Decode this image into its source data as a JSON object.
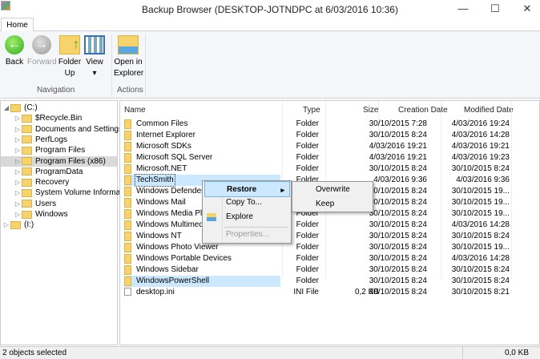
{
  "window": {
    "title": "Backup Browser (DESKTOP-JOTNDPC at 6/03/2016 10:36)",
    "minimize": "—",
    "maximize": "☐",
    "close": "✕"
  },
  "ribbon": {
    "tab": "Home",
    "buttons": [
      {
        "l1": "Back",
        "l2": ""
      },
      {
        "l1": "Forward",
        "l2": ""
      },
      {
        "l1": "Folder",
        "l2": "Up"
      },
      {
        "l1": "View",
        "l2": "▾"
      },
      {
        "l1": "Open in",
        "l2": "Explorer"
      }
    ],
    "groups": [
      "Navigation",
      "Actions"
    ]
  },
  "tree": [
    {
      "label": "(C:)",
      "arrow": "◢",
      "level": 0
    },
    {
      "label": "$Recycle.Bin",
      "arrow": "▷",
      "level": 1
    },
    {
      "label": "Documents and Settings",
      "arrow": "▷",
      "level": 1
    },
    {
      "label": "PerfLogs",
      "arrow": "▷",
      "level": 1
    },
    {
      "label": "Program Files",
      "arrow": "▷",
      "level": 1
    },
    {
      "label": "Program Files (x86)",
      "arrow": "▷",
      "level": 1,
      "selected": true
    },
    {
      "label": "ProgramData",
      "arrow": "▷",
      "level": 1
    },
    {
      "label": "Recovery",
      "arrow": "▷",
      "level": 1
    },
    {
      "label": "System Volume Informati",
      "arrow": "▷",
      "level": 1
    },
    {
      "label": "Users",
      "arrow": "▷",
      "level": 1
    },
    {
      "label": "Windows",
      "arrow": "▷",
      "level": 1
    },
    {
      "label": "(I:)",
      "arrow": "▷",
      "level": 0
    }
  ],
  "columns": {
    "name": "Name",
    "type": "Type",
    "size": "Size",
    "created": "Creation Date",
    "modified": "Modified Date"
  },
  "files": [
    {
      "name": "Common Files",
      "type": "Folder",
      "size": "",
      "created": "30/10/2015 7:28",
      "modified": "4/03/2016 19:24"
    },
    {
      "name": "Internet Explorer",
      "type": "Folder",
      "size": "",
      "created": "30/10/2015 8:24",
      "modified": "4/03/2016 14:28"
    },
    {
      "name": "Microsoft SDKs",
      "type": "Folder",
      "size": "",
      "created": "4/03/2016 19:21",
      "modified": "4/03/2016 19:21"
    },
    {
      "name": "Microsoft SQL Server",
      "type": "Folder",
      "size": "",
      "created": "4/03/2016 19:21",
      "modified": "4/03/2016 19:23"
    },
    {
      "name": "Microsoft.NET",
      "type": "Folder",
      "size": "",
      "created": "30/10/2015 8:24",
      "modified": "30/10/2015 8:24"
    },
    {
      "name": "TechSmith",
      "type": "Folder",
      "size": "",
      "created": "4/03/2016 9:36",
      "modified": "4/03/2016 9:36",
      "selected": true
    },
    {
      "name": "Windows Defender",
      "type": "Folder",
      "size": "",
      "created": "30/10/2015 8:24",
      "modified": "30/10/2015 19..."
    },
    {
      "name": "Windows Mail",
      "type": "Folder",
      "size": "",
      "created": "30/10/2015 8:24",
      "modified": "30/10/2015 19..."
    },
    {
      "name": "Windows Media Player",
      "type": "Folder",
      "size": "",
      "created": "30/10/2015 8:24",
      "modified": "30/10/2015 19..."
    },
    {
      "name": "Windows Multimedia Platform",
      "type": "Folder",
      "size": "",
      "created": "30/10/2015 8:24",
      "modified": "4/03/2016 14:28"
    },
    {
      "name": "Windows NT",
      "type": "Folder",
      "size": "",
      "created": "30/10/2015 8:24",
      "modified": "30/10/2015 8:24"
    },
    {
      "name": "Windows Photo Viewer",
      "type": "Folder",
      "size": "",
      "created": "30/10/2015 8:24",
      "modified": "30/10/2015 19..."
    },
    {
      "name": "Windows Portable Devices",
      "type": "Folder",
      "size": "",
      "created": "30/10/2015 8:24",
      "modified": "4/03/2016 14:28"
    },
    {
      "name": "Windows Sidebar",
      "type": "Folder",
      "size": "",
      "created": "30/10/2015 8:24",
      "modified": "30/10/2015 8:24"
    },
    {
      "name": "WindowsPowerShell",
      "type": "Folder",
      "size": "",
      "created": "30/10/2015 8:24",
      "modified": "30/10/2015 8:24",
      "selected": true
    },
    {
      "name": "desktop.ini",
      "type": "INI File",
      "size": "0,2 KB",
      "created": "30/10/2015 8:24",
      "modified": "30/10/2015 8:21",
      "file": true
    }
  ],
  "context_menu": {
    "items": [
      "Restore",
      "Copy To...",
      "Explore",
      "Properties..."
    ],
    "submenu_arrow": "▸",
    "submenu": [
      "Overwrite",
      "Keep"
    ]
  },
  "status": {
    "left": "2 objects selected",
    "right": "0,0 KB"
  }
}
